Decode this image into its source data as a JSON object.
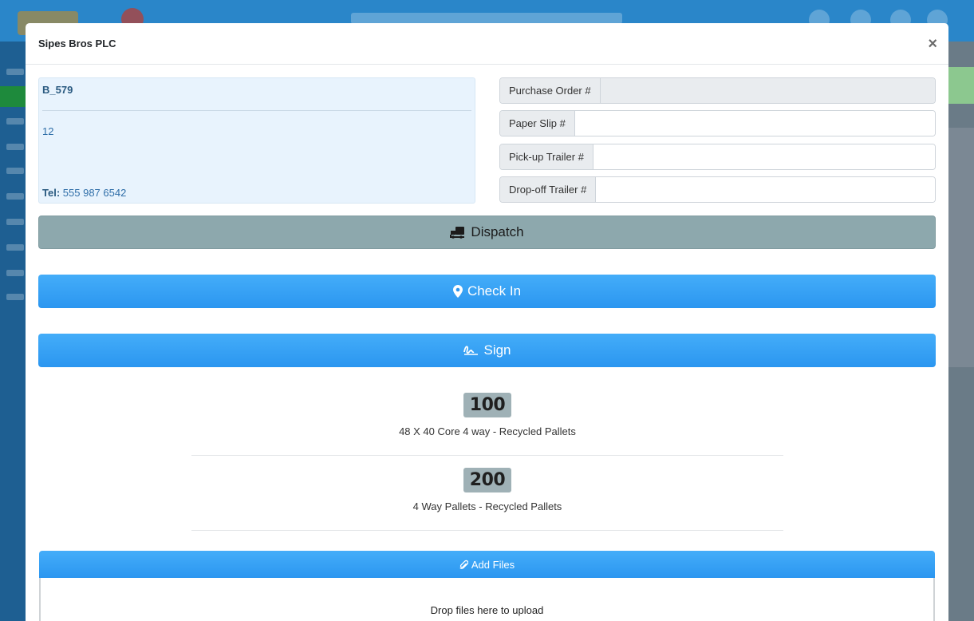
{
  "modal": {
    "title": "Sipes Bros PLC",
    "close_label": "×"
  },
  "customer": {
    "code": "B_579",
    "number": "12",
    "tel_label": "Tel:",
    "tel_value": "555 987 6542"
  },
  "fields": [
    {
      "label": "Purchase Order #",
      "value": "",
      "readonly": true
    },
    {
      "label": "Paper Slip #",
      "value": ""
    },
    {
      "label": "Pick-up Trailer #",
      "value": ""
    },
    {
      "label": "Drop-off Trailer #",
      "value": ""
    }
  ],
  "actions": {
    "dispatch": {
      "label": "Dispatch",
      "icon": "truck-loading-icon"
    },
    "check_in": {
      "label": "Check In",
      "icon": "map-marker-icon"
    },
    "sign": {
      "label": "Sign",
      "icon": "signature-icon"
    }
  },
  "items": [
    {
      "quantity": "100",
      "description": "48 X 40 Core 4 way - Recycled Pallets"
    },
    {
      "quantity": "200",
      "description": "4 Way Pallets - Recycled Pallets"
    }
  ],
  "files": {
    "add_label": "Add Files",
    "add_icon": "paperclip-icon",
    "dropzone_text": "Drop files here to upload"
  },
  "colors": {
    "primary_button": "#2b96f0",
    "dispatch_button": "#8da8ad",
    "info_box": "#e8f3fd",
    "qty_badge": "#9fb1b6"
  }
}
